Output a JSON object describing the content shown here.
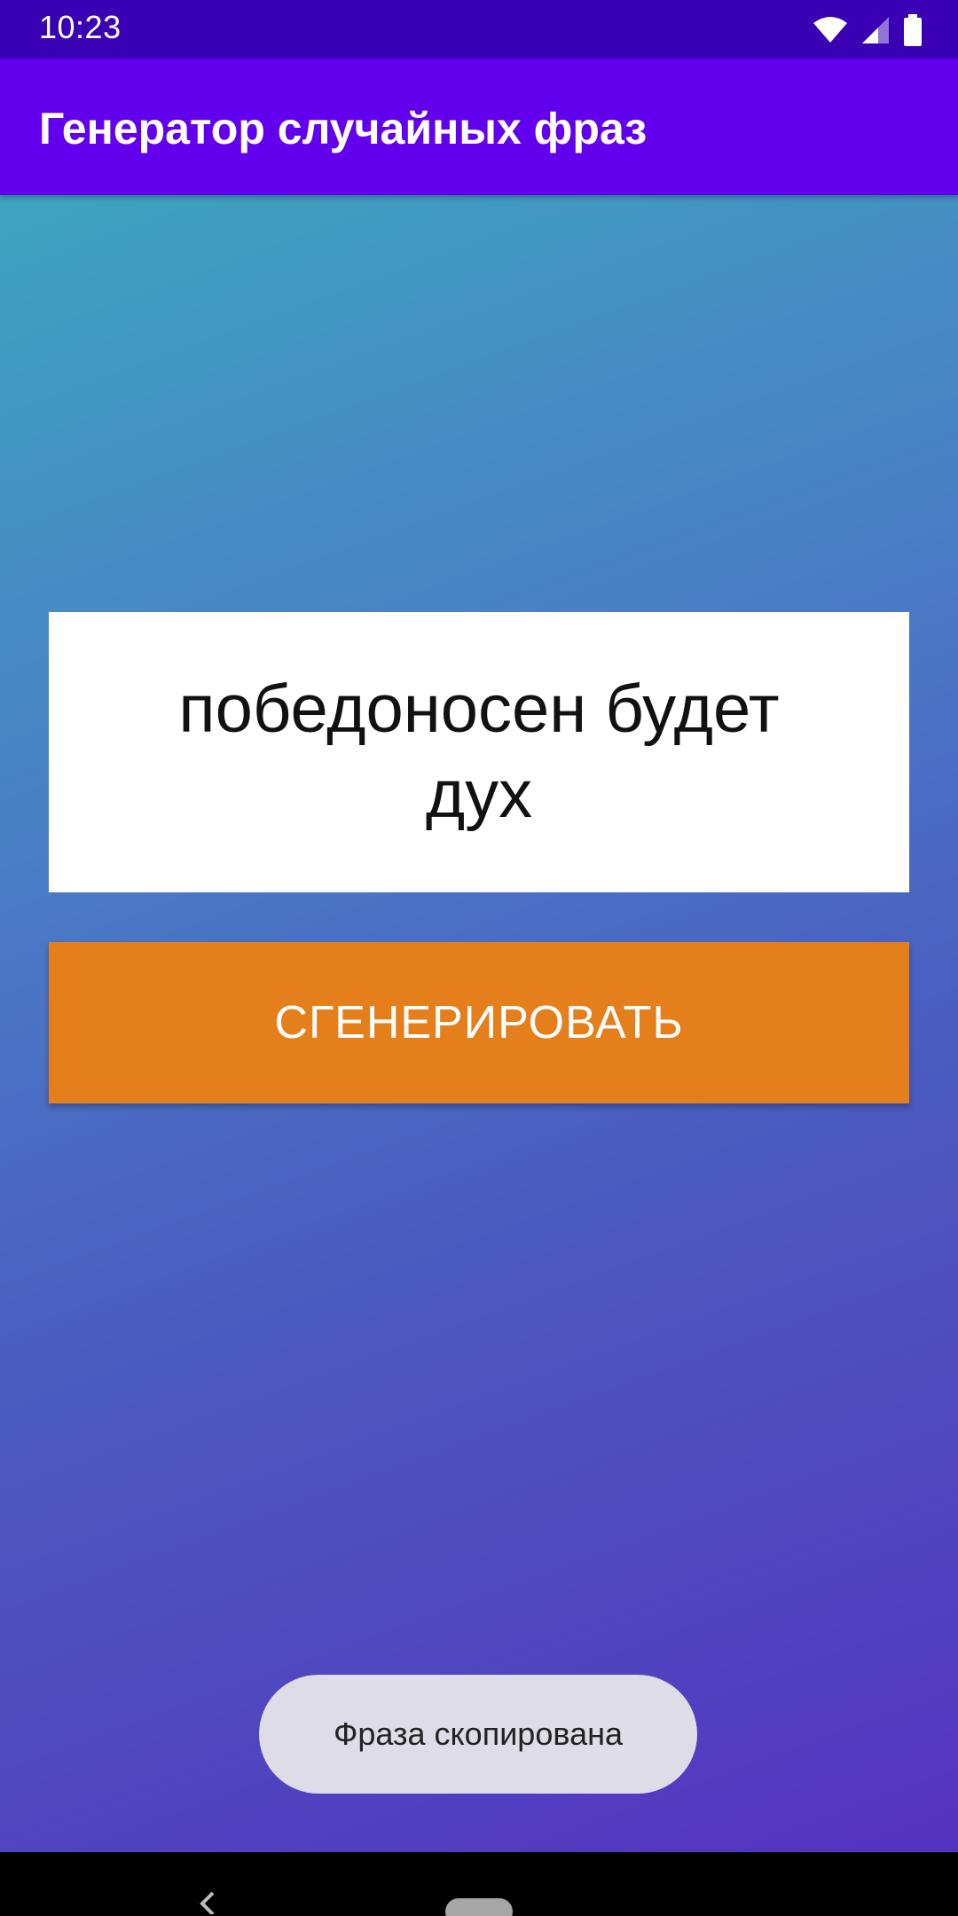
{
  "status_bar": {
    "time": "10:23",
    "icons": [
      "wifi-icon",
      "cell-signal-icon",
      "battery-icon"
    ]
  },
  "app_bar": {
    "title": "Генератор случайных фраз",
    "color": "#6200EE"
  },
  "phrase": {
    "text": "победоносен будет дух"
  },
  "generate_button": {
    "label": "СГЕНЕРИРОВАТЬ",
    "color": "#E47F1B"
  },
  "toast": {
    "message": "Фраза скопирована"
  },
  "nav_bar": {
    "icons": [
      "back-icon",
      "home-pill-icon"
    ]
  }
}
